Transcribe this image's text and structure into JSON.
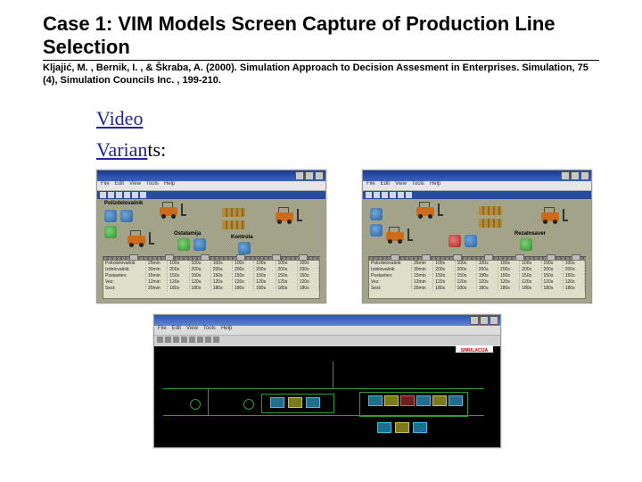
{
  "title": "Case 1: VIM Models Screen Capture of  Production Line Selection",
  "citation": "Kljajić, M. , Bernik, I. , & Škraba, A. (2000). Simulation Approach to Decision Assesment in Enterprises. Simulation, 75 (4), Simulation Councils Inc. , 199-210.",
  "links": {
    "video": "Video",
    "variants_link_part": "Varian",
    "variants_rest": "ts:"
  },
  "dark_splash": "SIMULACIJA",
  "menu_items": [
    "File",
    "Edit",
    "View",
    "Tools",
    "Help"
  ],
  "table": {
    "row_labels": [
      "Polizdelovalnik:",
      "Izdelovalnik:",
      "Postavitev:",
      "Vez:",
      "Sest:"
    ],
    "cells": [
      [
        "25min",
        "100s",
        "100s",
        "100s",
        "100s",
        "100s",
        "100s",
        "100s"
      ],
      [
        "30min",
        "200s",
        "200s",
        "200s",
        "200s",
        "200s",
        "200s",
        "200s"
      ],
      [
        "15min",
        "150s",
        "150s",
        "150s",
        "150s",
        "150s",
        "150s",
        "150s"
      ],
      [
        "12min",
        "120s",
        "120s",
        "120s",
        "120s",
        "120s",
        "120s",
        "120s"
      ],
      [
        "20min",
        "180s",
        "180s",
        "180s",
        "180s",
        "180s",
        "180s",
        "180s"
      ]
    ]
  },
  "labels": {
    "polizdelovalnik": "Polizdelovalnik",
    "ostalamija": "Ostalamija",
    "tostalmer": "Kontrola",
    "rezalnsaver": "Rezalnsaver"
  }
}
